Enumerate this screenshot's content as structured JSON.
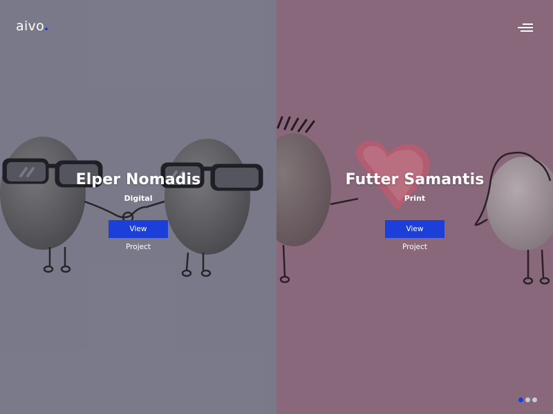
{
  "logo": {
    "text": "aivo"
  },
  "menu": {
    "icon": "hamburger-menu-icon"
  },
  "projects": [
    {
      "title": "Elper Nomadis",
      "category": "Digital",
      "button": "View Project"
    },
    {
      "title": "Futter Samantis",
      "category": "Print",
      "button": "View Project"
    }
  ],
  "pagination": {
    "count": 3,
    "active": 1
  },
  "colors": {
    "accent": "#1d3fd9",
    "text": "#ffffff"
  }
}
